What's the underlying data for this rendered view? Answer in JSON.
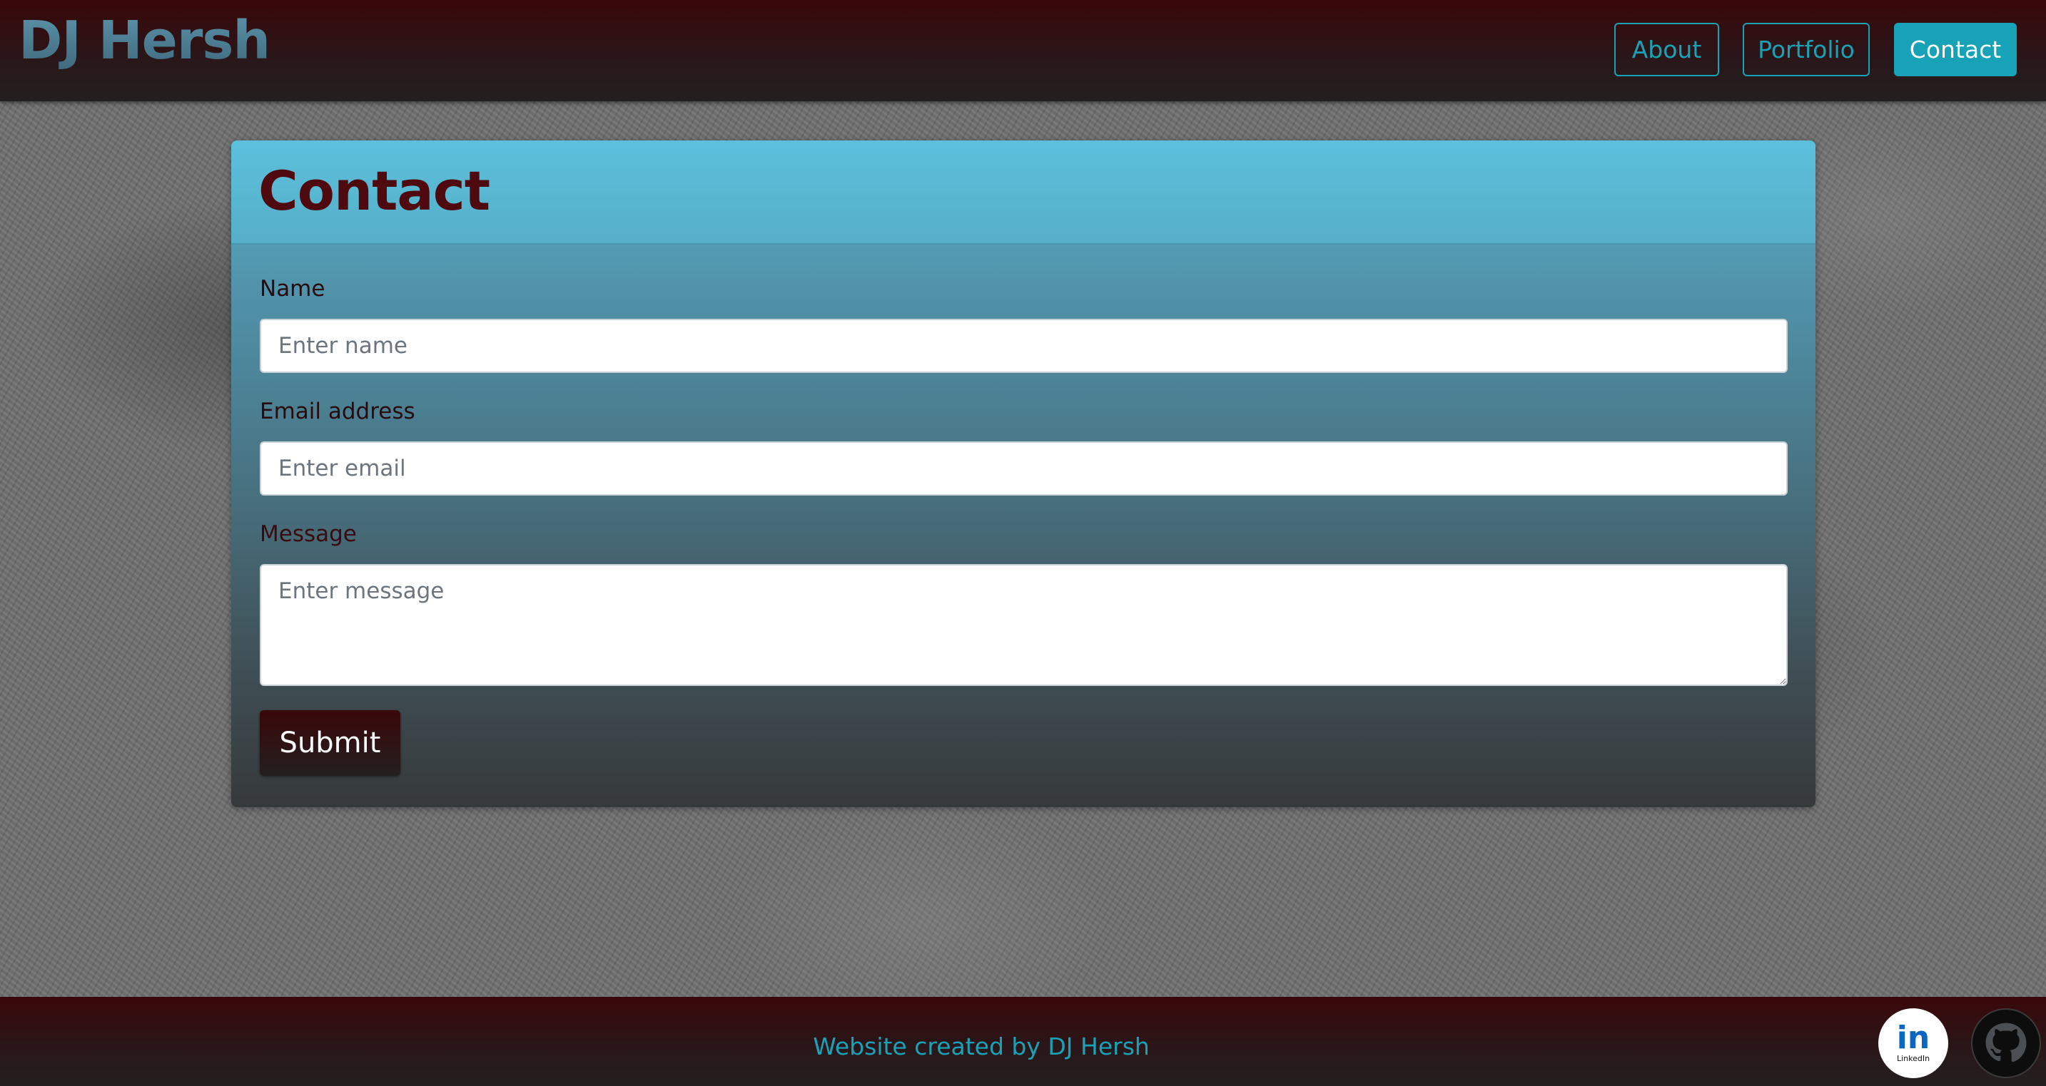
{
  "header": {
    "brand": "DJ Hersh",
    "nav": [
      {
        "label": "About"
      },
      {
        "label": "Portfolio"
      },
      {
        "label": "Contact",
        "active": true
      }
    ]
  },
  "contact_form": {
    "title": "Contact",
    "name_label": "Name",
    "name_placeholder": "Enter name",
    "email_label": "Email address",
    "email_placeholder": "Enter email",
    "message_label": "Message",
    "message_placeholder": "Enter message",
    "submit_label": "Submit"
  },
  "footer": {
    "text": "Website created by DJ Hersh",
    "social": [
      {
        "icon": "linkedin-icon",
        "label": "in",
        "sublabel": "LinkedIn"
      },
      {
        "icon": "github-icon"
      }
    ]
  },
  "colors": {
    "accent": "#17a2b8",
    "brand_dark": "#3a0709",
    "card_header": "#5cc0dc",
    "title": "#4e0a0e"
  }
}
